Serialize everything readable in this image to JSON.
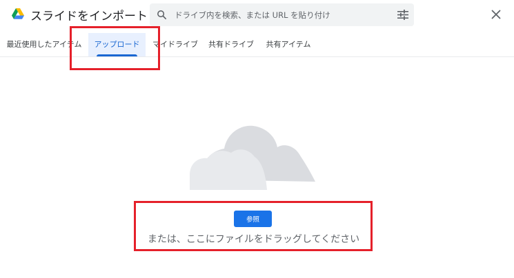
{
  "header": {
    "title": "スライドをインポート",
    "logo_icon": "google-drive-icon",
    "search_placeholder": "ドライブ内を検索、または URL を貼り付け",
    "search_icon": "search-icon",
    "filter_icon": "tune-icon",
    "close_icon": "close-icon"
  },
  "tabs": [
    {
      "label": "最近使用したアイテム",
      "active": false
    },
    {
      "label": "アップロード",
      "active": true
    },
    {
      "label": "マイドライブ",
      "active": false
    },
    {
      "label": "共有ドライブ",
      "active": false
    },
    {
      "label": "共有アイテム",
      "active": false
    }
  ],
  "upload": {
    "illustration": "cloud-icon",
    "browse_label": "参照",
    "drop_text": "または、ここにファイルをドラッグしてください"
  },
  "colors": {
    "accent": "#1a73e8",
    "active_tab_bg": "#e8f0fe",
    "highlight_box": "#e5202a",
    "cloud_back": "#dadce0",
    "cloud_front": "#e8eaed"
  }
}
